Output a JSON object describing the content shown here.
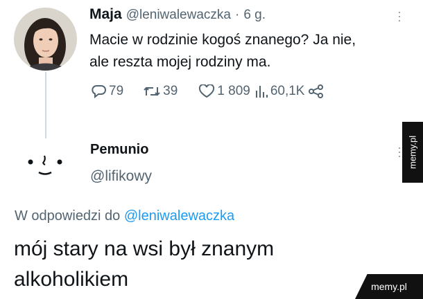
{
  "tweet": {
    "author_name": "Maja",
    "author_handle": "@leniwalewaczka",
    "separator": "·",
    "time": "6 g.",
    "text_line1": "Macie w rodzinie kogoś znanego? Ja nie,",
    "text_line2": "ale reszta mojej rodziny ma.",
    "stats": {
      "replies": "79",
      "retweets": "39",
      "likes": "1 809",
      "views": "60,1K"
    }
  },
  "reply": {
    "author_name": "Pemunio",
    "author_handle": "@lifikowy",
    "in_reply_prefix": "W odpowiedzi do",
    "in_reply_handle": "@leniwalewaczka",
    "text_line1": "mój stary na wsi był znanym",
    "text_line2": "alkoholikiem"
  },
  "watermark": {
    "side": "memy.pl",
    "bottom": "memy.pl"
  },
  "colors": {
    "link": "#1d9bf0",
    "muted": "#536471",
    "thread_line": "#cfd9de"
  }
}
